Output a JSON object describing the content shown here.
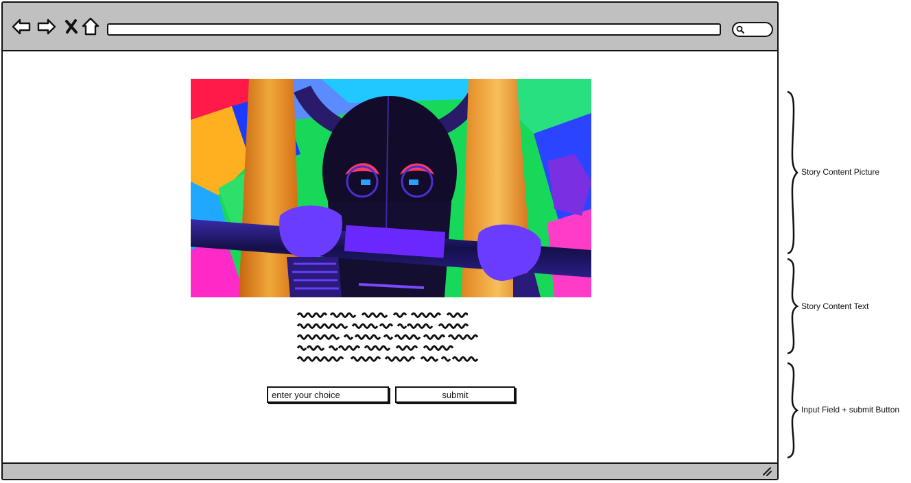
{
  "browser": {
    "address_value": "",
    "search_placeholder": ""
  },
  "icons": {
    "back": "arrow-left-icon",
    "forward": "arrow-right-icon",
    "stop": "close-icon",
    "home": "home-icon",
    "search": "search-icon",
    "resize": "resize-grip-icon"
  },
  "story": {
    "input_placeholder": "enter your choice",
    "submit_label": "submit"
  },
  "annotations": {
    "picture": "Story Content Picture",
    "text": "Story Content Text",
    "input": "Input Field + submit Button"
  },
  "colors": {
    "chrome": "#c0c0c0",
    "outline": "#111111",
    "page": "#ffffff"
  }
}
